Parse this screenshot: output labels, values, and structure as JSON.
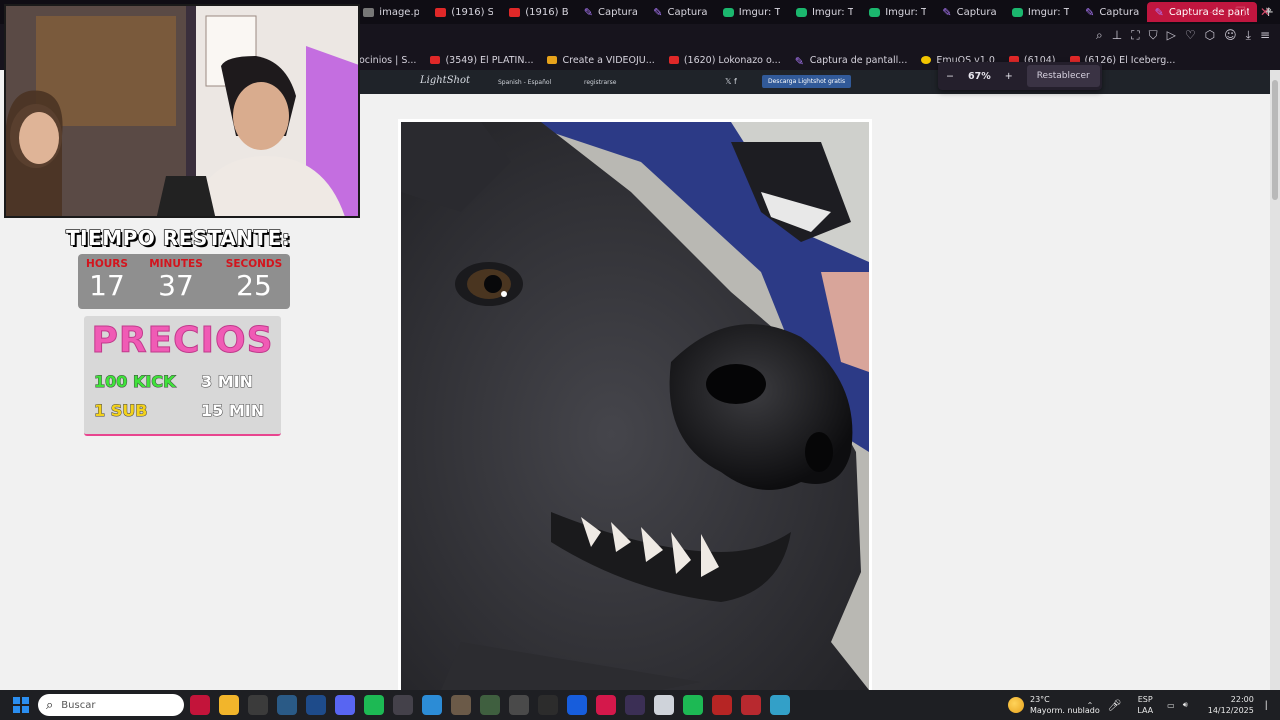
{
  "tabs": [
    {
      "label": "image.p",
      "favicon": "image-favicon",
      "active": false
    },
    {
      "label": "(1916) S",
      "favicon": "youtube-icon",
      "active": false
    },
    {
      "label": "(1916) B",
      "favicon": "youtube-icon",
      "active": false
    },
    {
      "label": "Captura",
      "favicon": "lightshot-icon",
      "active": false
    },
    {
      "label": "Captura",
      "favicon": "lightshot-icon",
      "active": false
    },
    {
      "label": "Imgur: T",
      "favicon": "imgur-icon",
      "active": false
    },
    {
      "label": "Imgur: T",
      "favicon": "imgur-icon",
      "active": false
    },
    {
      "label": "Imgur: T",
      "favicon": "imgur-icon",
      "active": false
    },
    {
      "label": "Captura",
      "favicon": "lightshot-icon",
      "active": false
    },
    {
      "label": "Imgur: T",
      "favicon": "imgur-icon",
      "active": false
    },
    {
      "label": "Captura",
      "favicon": "lightshot-icon",
      "active": false
    },
    {
      "label": "Captura de pant",
      "favicon": "lightshot-icon",
      "active": true
    }
  ],
  "bookmarks": [
    {
      "label": "ocinios | S...",
      "favicon": "none"
    },
    {
      "label": "(3549) El PLATIN...",
      "favicon": "youtube-icon"
    },
    {
      "label": "Create a VIDEOJU...",
      "favicon": "game-icon"
    },
    {
      "label": "(1620) Lokonazo o...",
      "favicon": "youtube-icon"
    },
    {
      "label": "Captura de pantall...",
      "favicon": "lightshot-icon"
    },
    {
      "label": "EmuOS v1.0",
      "favicon": "emu-icon"
    },
    {
      "label": "(6104)",
      "favicon": "youtube-icon"
    },
    {
      "label": "(6126) El Iceberg...",
      "favicon": "youtube-icon"
    }
  ],
  "zoom": {
    "minus": "−",
    "value": "67%",
    "plus": "+",
    "reset_label": "Restablecer"
  },
  "lightshot": {
    "logo": "LightShot",
    "language": "Spanish - Español",
    "register": "registrarse",
    "download": "Descarga Lightshot gratis",
    "social": "𝕏 f"
  },
  "overlay": {
    "timer_title": "TIEMPO RESTANTE:",
    "timer": [
      {
        "label": "HOURS",
        "value": "17"
      },
      {
        "label": "MINUTES",
        "value": "37"
      },
      {
        "label": "SECONDS",
        "value": "25"
      }
    ],
    "prices_title": "PRECIOS",
    "prices": [
      {
        "item": "100 KICK",
        "time": "3 MIN",
        "item_color": "#3fe23a"
      },
      {
        "item": "1 SUB",
        "time": "15 MIN",
        "item_color": "#f3d21c"
      }
    ]
  },
  "taskbar": {
    "search_placeholder": "Buscar",
    "weather_temp": "23°C",
    "weather_desc": "Mayorm. nublado",
    "lang": "ESP",
    "lang2": "LAA",
    "time": "22:00",
    "date": "14/12/2025",
    "apps": [
      {
        "name": "opera-gx-icon",
        "color": "#c3143a"
      },
      {
        "name": "file-explorer-icon",
        "color": "#f2b52b"
      },
      {
        "name": "chrome-icon",
        "color": "#3b3b3b"
      },
      {
        "name": "steam-icon",
        "color": "#2a5a86"
      },
      {
        "name": "app-icon-5",
        "color": "#1e4b8a"
      },
      {
        "name": "discord-icon",
        "color": "#5865f2"
      },
      {
        "name": "spotify-icon",
        "color": "#1db954"
      },
      {
        "name": "app-icon-8",
        "color": "#44414a"
      },
      {
        "name": "notepad-icon",
        "color": "#2c8cd6"
      },
      {
        "name": "game-icon-1",
        "color": "#6b5a48"
      },
      {
        "name": "game-icon-2",
        "color": "#3f5f3f"
      },
      {
        "name": "car-icon",
        "color": "#4a4a4a"
      },
      {
        "name": "app-icon-13",
        "color": "#2c2c2c"
      },
      {
        "name": "bitwarden-icon",
        "color": "#175ddc"
      },
      {
        "name": "app-icon-15",
        "color": "#d4184b"
      },
      {
        "name": "app-icon-16",
        "color": "#3b2f55"
      },
      {
        "name": "obs-icon",
        "color": "#cfd3da"
      },
      {
        "name": "spotify-icon-2",
        "color": "#1db954"
      },
      {
        "name": "voicemeeter-icon",
        "color": "#b62524"
      },
      {
        "name": "shield-icon",
        "color": "#b8292f"
      },
      {
        "name": "globe-icon",
        "color": "#33a0c8"
      }
    ]
  },
  "colors": {
    "accent": "#c0163f",
    "timer_label": "#d3141d",
    "prices_title": "#f05bb5"
  }
}
